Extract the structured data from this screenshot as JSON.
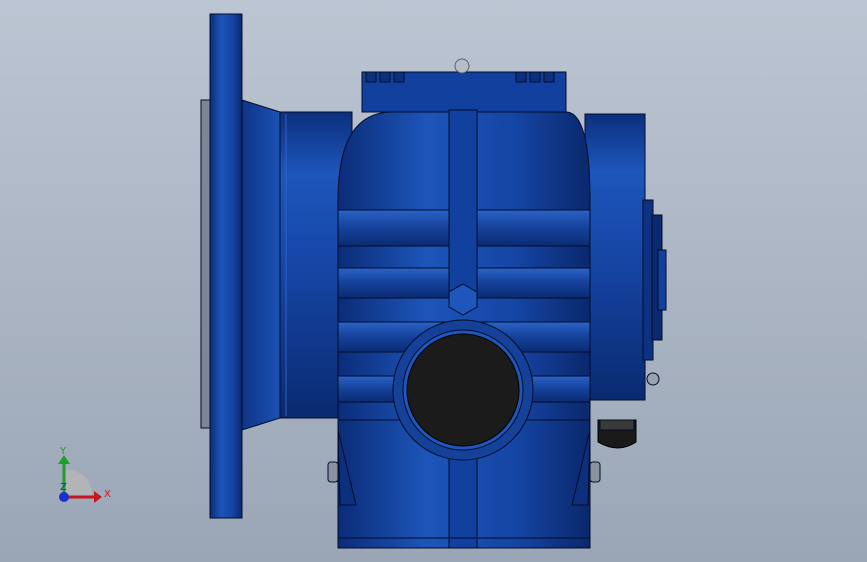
{
  "viewport": {
    "background_top": "#bcc5d2",
    "background_bottom": "#9aa6b6"
  },
  "model": {
    "body_color": "#12409e",
    "dark_color": "#061a52",
    "highlight_color": "#2a63c8",
    "edge_color": "#030c2a",
    "port_color": "#1b1b1b",
    "flange_rim_color": "#7d8695"
  },
  "triad": {
    "x_label": "X",
    "y_label": "Y",
    "z_label": "Z",
    "x_color": "#c8141c",
    "y_color": "#1e9e2a",
    "z_color": "#1c2fd0"
  }
}
